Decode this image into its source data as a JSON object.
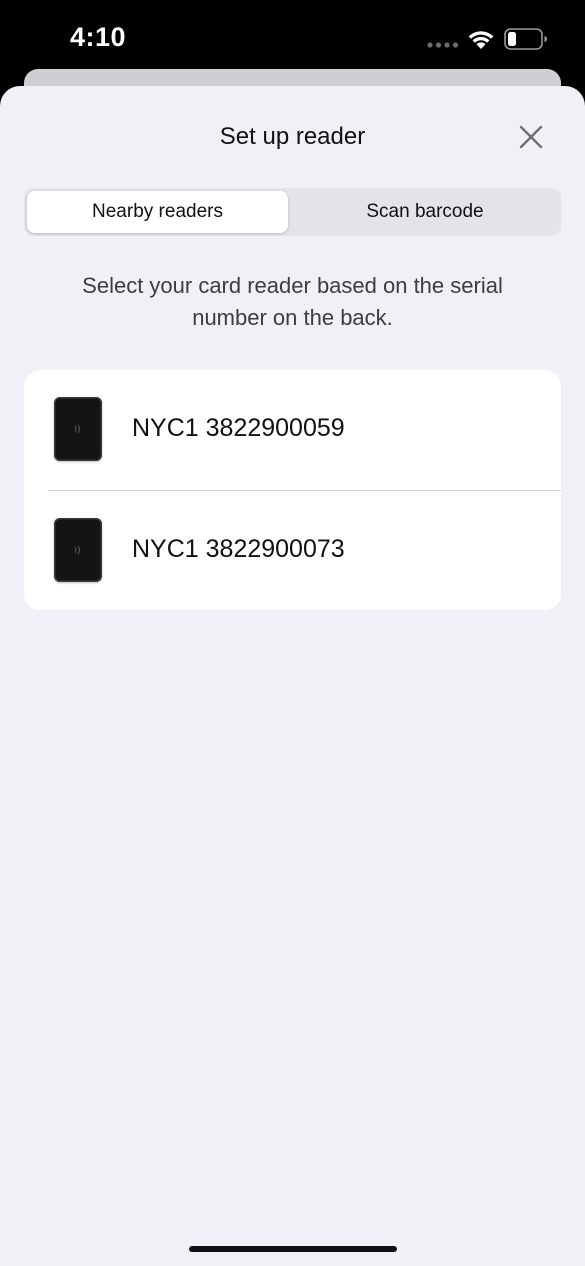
{
  "status_bar": {
    "time": "4:10",
    "icons": [
      "signal-dots-icon",
      "wifi-icon",
      "battery-icon"
    ]
  },
  "sheet": {
    "title": "Set up reader",
    "close_icon": "close-icon"
  },
  "segmented_control": {
    "tabs": [
      {
        "label": "Nearby readers",
        "selected": true
      },
      {
        "label": "Scan barcode",
        "selected": false
      }
    ]
  },
  "instructions": "Select your card reader based on the serial number on the back.",
  "readers": [
    {
      "label": "NYC1 3822900059",
      "icon": "card-reader-icon"
    },
    {
      "label": "NYC1 3822900073",
      "icon": "card-reader-icon"
    }
  ],
  "colors": {
    "sheet_background": "#f1f0f6",
    "card_background": "#ffffff",
    "segment_track": "#e4e3e9",
    "text_primary": "#111111",
    "text_secondary": "#3c3c43"
  }
}
